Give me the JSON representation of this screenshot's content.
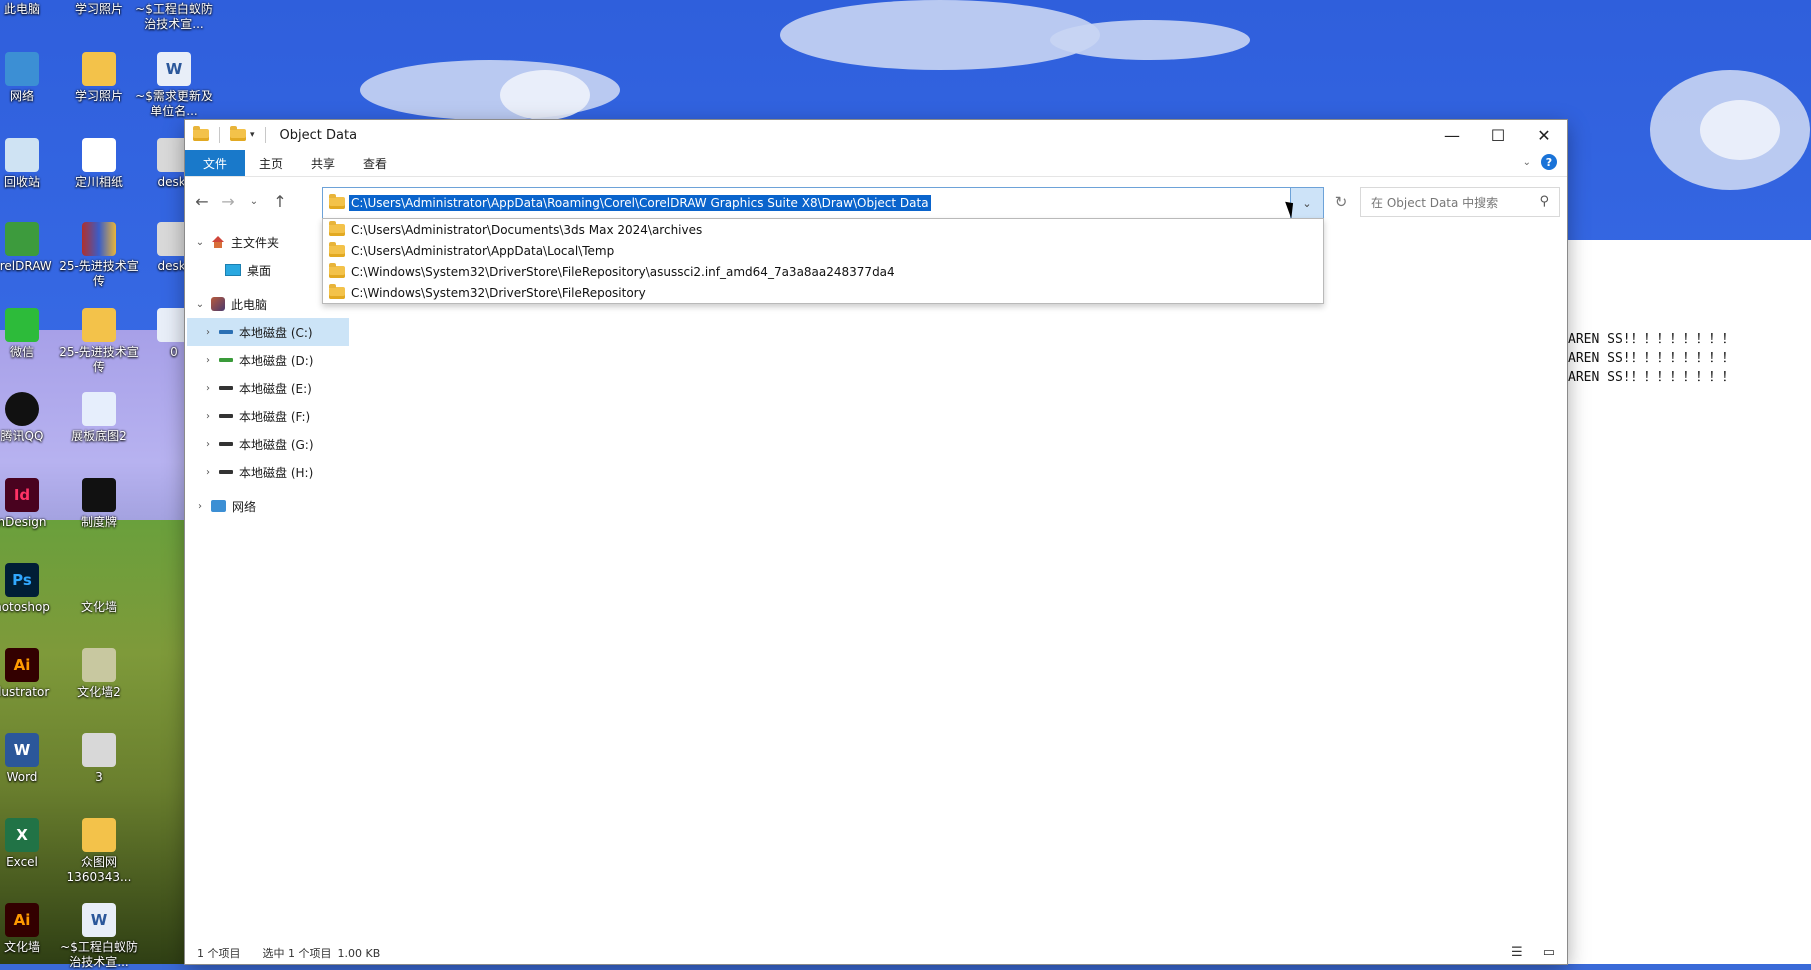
{
  "desktop": {
    "icons": [
      {
        "label": "此电脑"
      },
      {
        "label": "学习照片"
      },
      {
        "label": "~$工程白蚁防治技术宣..."
      },
      {
        "label": "网络"
      },
      {
        "label": "学习照片"
      },
      {
        "label": "~$需求更新及单位名..."
      },
      {
        "label": "回收站"
      },
      {
        "label": "定川相纸"
      },
      {
        "label": "deskt"
      },
      {
        "label": "orelDRAW"
      },
      {
        "label": "25-先进技术宣传"
      },
      {
        "label": "deskt"
      },
      {
        "label": "微信"
      },
      {
        "label": "25-先进技术宣传"
      },
      {
        "label": "0"
      },
      {
        "label": "腾讯QQ"
      },
      {
        "label": "展板底图2"
      },
      {
        "label": "nDesign"
      },
      {
        "label": "制度牌"
      },
      {
        "label": "hotoshop"
      },
      {
        "label": "文化墙"
      },
      {
        "label": "llustrator"
      },
      {
        "label": "文化墙2"
      },
      {
        "label": "Word"
      },
      {
        "label": "3"
      },
      {
        "label": "Excel"
      },
      {
        "label": "众图网1360343..."
      },
      {
        "label": "文化墙"
      },
      {
        "label": "~$工程白蚁防治技术宣..."
      }
    ],
    "app_badges": {
      "ps": "Ps",
      "ai": "Ai",
      "id": "Id"
    }
  },
  "window": {
    "title": "Object Data",
    "ribbon_tabs": [
      "文件",
      "主页",
      "共享",
      "查看"
    ],
    "help": "?",
    "address_path": "C:\\Users\\Administrator\\AppData\\Roaming\\Corel\\CorelDRAW Graphics Suite X8\\Draw\\Object Data",
    "search_placeholder": "在 Object Data 中搜索",
    "history": [
      "C:\\Users\\Administrator\\Documents\\3ds Max 2024\\archives",
      "C:\\Users\\Administrator\\AppData\\Local\\Temp",
      "C:\\Windows\\System32\\DriverStore\\FileRepository\\asussci2.inf_amd64_7a3a8aa248377da4",
      "C:\\Windows\\System32\\DriverStore\\FileRepository"
    ],
    "nav_pane": {
      "home": "主文件夹",
      "desktop": "桌面",
      "this_pc": "此电脑",
      "drives": [
        "本地磁盘 (C:)",
        "本地磁盘 (D:)",
        "本地磁盘 (E:)",
        "本地磁盘 (F:)",
        "本地磁盘 (G:)",
        "本地磁盘 (H:)"
      ],
      "network": "网络"
    },
    "status": {
      "count": "1 个项目",
      "selected": "选中 1 个项目",
      "size": "1.00 KB"
    }
  },
  "behind_text": [
    "AREN  SS!！！！！！！！！",
    "AREN  SS!！！！！！！！！",
    "AREN  SS!！！！！！！！！"
  ]
}
